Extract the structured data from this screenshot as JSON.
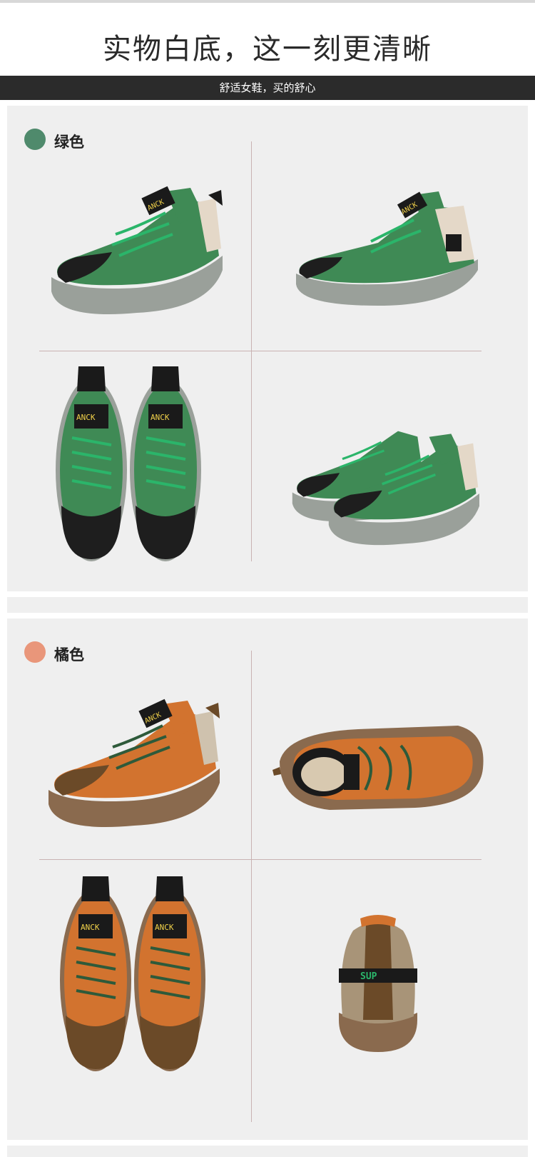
{
  "header": {
    "title": "实物白底，这一刻更清晰",
    "subtitle": "舒适女鞋，买的舒心"
  },
  "variants": [
    {
      "name": "绿色",
      "swatch_color": "#4f8a6c",
      "upper_color": "#3f8a55",
      "accent_color": "#2bb56a",
      "toe_color": "#1e1e1e",
      "sole_color": "#9aa09a",
      "tongue_label": "ANCK"
    },
    {
      "name": "橘色",
      "swatch_color": "#e9967a",
      "upper_color": "#d2732f",
      "accent_color": "#2e5a3a",
      "toe_color": "#6b4a28",
      "sole_color": "#8a6a4e",
      "tongue_label": "ANCK",
      "heel_label": "SUP"
    }
  ]
}
